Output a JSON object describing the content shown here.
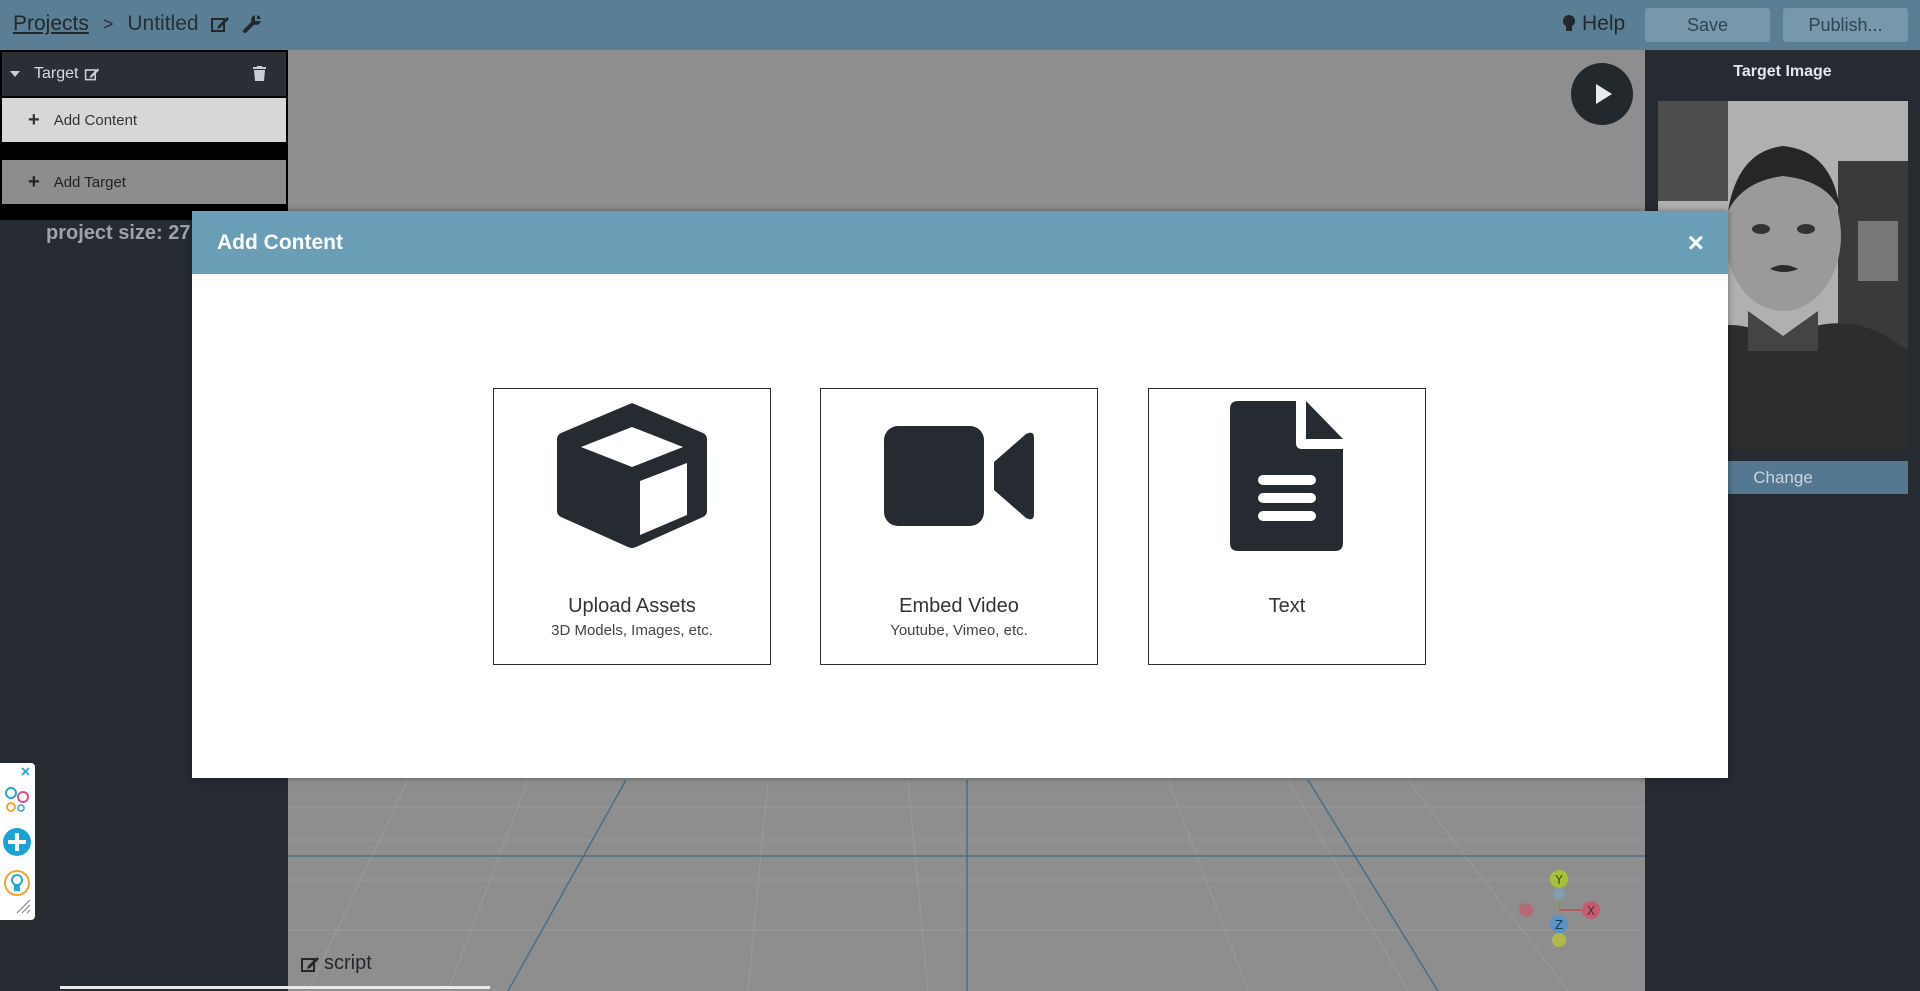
{
  "topbar": {
    "projects_link": "Projects",
    "separator": ">",
    "project_name": "Untitled",
    "help_label": "Help",
    "save_label": "Save",
    "publish_label": "Publish..."
  },
  "left_panel": {
    "target_label": "Target",
    "add_content_label": "Add Content",
    "add_target_label": "Add Target",
    "project_size_label": "project size: 27"
  },
  "viewport": {
    "script_label": "script",
    "axes": {
      "x": "X",
      "y": "Y",
      "z": "Z"
    }
  },
  "right_panel": {
    "title": "Target Image",
    "change_label": "Change"
  },
  "modal": {
    "title": "Add Content",
    "close_glyph": "×",
    "options": [
      {
        "title": "Upload Assets",
        "subtitle": "3D Models, Images, etc.",
        "icon": "cube-icon"
      },
      {
        "title": "Embed Video",
        "subtitle": "Youtube, Vimeo, etc.",
        "icon": "video-camera-icon"
      },
      {
        "title": "Text",
        "subtitle": "",
        "icon": "document-icon"
      }
    ]
  },
  "colors": {
    "topbar": "#5a7f94",
    "modal_header": "#6a9db6",
    "panel_bg": "#262b31",
    "viewport_bg": "#8e8e8e"
  }
}
